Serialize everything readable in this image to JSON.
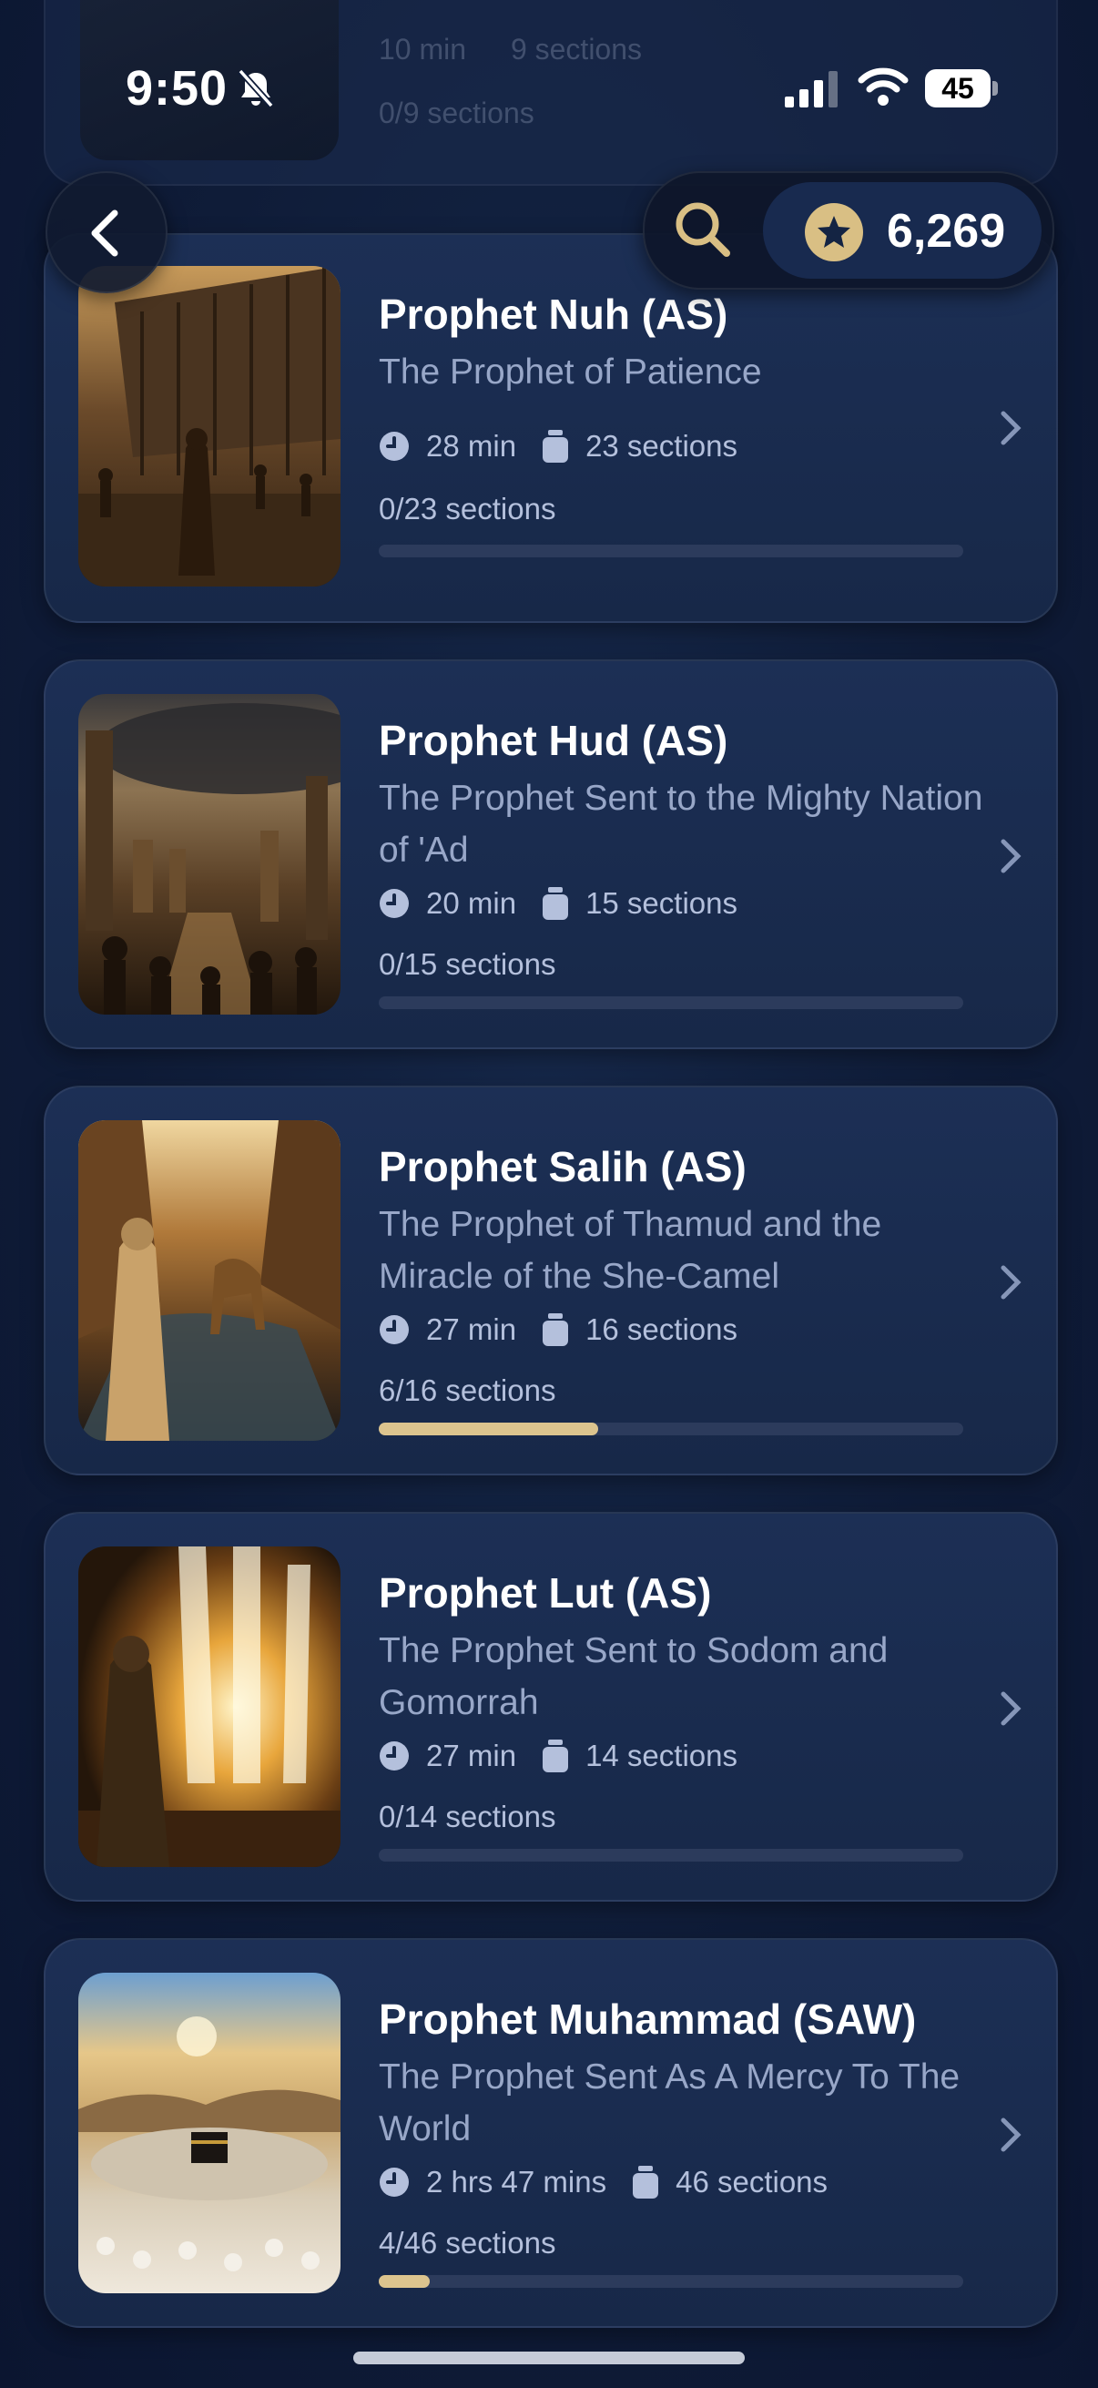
{
  "status_bar": {
    "time": "9:50",
    "battery": "45"
  },
  "header": {
    "points": "6,269"
  },
  "previous_item": {
    "duration": "10 min",
    "sections": "9 sections",
    "progress_label": "0/9 sections"
  },
  "stories": [
    {
      "title": "Prophet Nuh (AS)",
      "subtitle": "The Prophet of Patience",
      "duration": "28 min",
      "sections": "23 sections",
      "progress_label": "0/23 sections",
      "progress": 0
    },
    {
      "title": "Prophet Hud (AS)",
      "subtitle": "The Prophet Sent to the Mighty Nation of 'Ad",
      "duration": "20 min",
      "sections": "15 sections",
      "progress_label": "0/15 sections",
      "progress": 0
    },
    {
      "title": "Prophet Salih (AS)",
      "subtitle": "The Prophet of Thamud and the Miracle of the She-Camel",
      "duration": "27 min",
      "sections": "16 sections",
      "progress_label": "6/16 sections",
      "progress": 0.375
    },
    {
      "title": "Prophet Lut (AS)",
      "subtitle": "The Prophet Sent to Sodom and Gomorrah",
      "duration": "27 min",
      "sections": "14 sections",
      "progress_label": "0/14 sections",
      "progress": 0
    },
    {
      "title": "Prophet Muhammad (SAW)",
      "subtitle": "The Prophet Sent As A Mercy To The World",
      "duration": "2 hrs 47 mins",
      "sections": "46 sections",
      "progress_label": "4/46 sections",
      "progress": 0.087
    }
  ],
  "colors": {
    "accent": "#dcc48e",
    "card": "#1c2f55",
    "background": "#0f1c38"
  }
}
